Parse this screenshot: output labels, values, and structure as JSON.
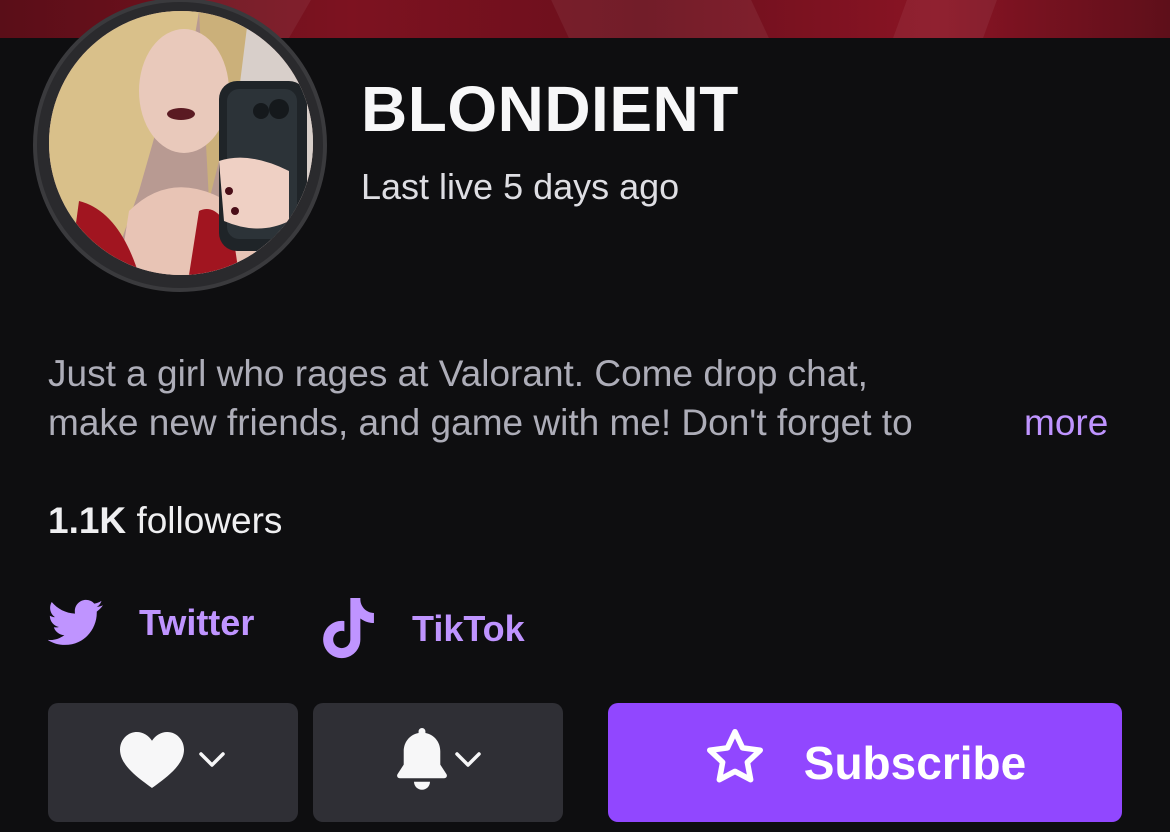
{
  "channel": {
    "username": "BLONDIENT",
    "last_live": "Last live 5 days ago"
  },
  "bio": {
    "line1": "Just a girl who rages at Valorant. Come drop chat,",
    "line2": "make new friends, and game with me! Don't forget to",
    "more_label": "more"
  },
  "stats": {
    "followers_count": "1.1K",
    "followers_label": "followers"
  },
  "social_links": [
    {
      "label": "Twitter",
      "icon": "twitter-bird-icon"
    },
    {
      "label": "TikTok",
      "icon": "tiktok-note-icon"
    }
  ],
  "actions": {
    "follow_icon": "heart-icon",
    "notify_icon": "bell-icon",
    "subscribe_label": "Subscribe",
    "subscribe_icon": "star-outline-icon"
  },
  "colors": {
    "background": "#0e0e10",
    "accent": "#9147ff",
    "link": "#bf94ff",
    "button_secondary": "#2f2f35"
  }
}
